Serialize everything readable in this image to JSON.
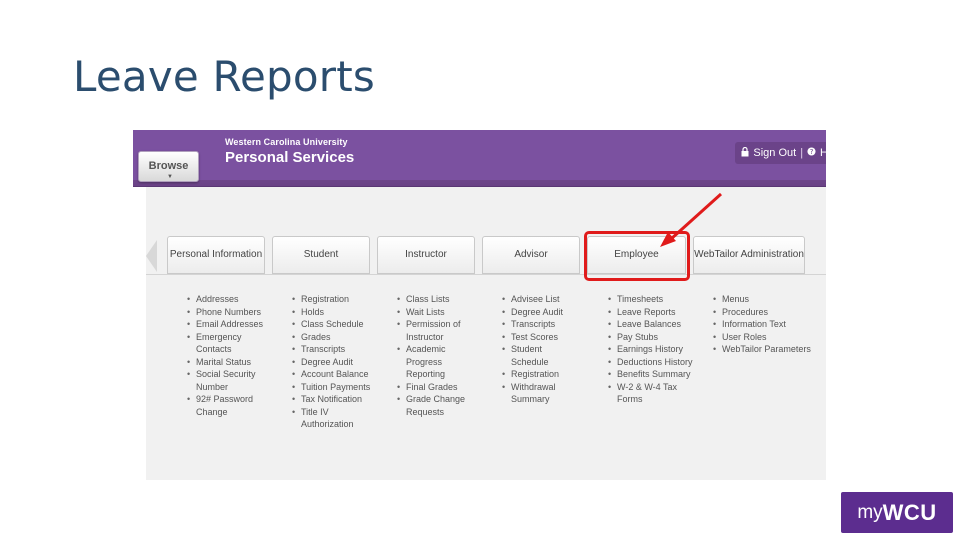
{
  "slide": {
    "title": "Leave Reports"
  },
  "header": {
    "browse_label": "Browse",
    "university": "Western Carolina University",
    "app_name": "Personal Services",
    "sign_out_label": "Sign Out",
    "help_label": "H"
  },
  "tabs": [
    {
      "label": "Personal Information"
    },
    {
      "label": "Student"
    },
    {
      "label": "Instructor"
    },
    {
      "label": "Advisor"
    },
    {
      "label": "Employee"
    },
    {
      "label": "WebTailor Administration"
    }
  ],
  "columns": {
    "personal_information": [
      "Addresses",
      "Phone Numbers",
      "Email Addresses",
      "Emergency Contacts",
      "Marital Status",
      "Social Security Number",
      "92# Password Change"
    ],
    "student": [
      "Registration",
      "Holds",
      "Class Schedule",
      "Grades",
      "Transcripts",
      "Degree Audit",
      "Account Balance",
      "Tuition Payments",
      "Tax Notification",
      "Title IV Authorization"
    ],
    "instructor": [
      "Class Lists",
      "Wait Lists",
      "Permission of Instructor",
      "Academic Progress Reporting",
      "Final Grades",
      "Grade Change Requests"
    ],
    "advisor": [
      "Advisee List",
      "Degree Audit",
      "Transcripts",
      "Test Scores",
      "Student Schedule",
      "Registration",
      "Withdrawal Summary"
    ],
    "employee": [
      "Timesheets",
      "Leave Reports",
      "Leave Balances",
      "Pay Stubs",
      "Earnings History",
      "Deductions History",
      "Benefits Summary",
      "W-2 & W-4 Tax Forms"
    ],
    "webtailor_administration": [
      "Menus",
      "Procedures",
      "Information Text",
      "User Roles",
      "WebTailor Parameters"
    ]
  },
  "logo": {
    "my": "my",
    "wcu": "WCU"
  },
  "colors": {
    "title": "#2b4d6e",
    "header_purple": "#7b51a0",
    "highlight_red": "#e01b1b",
    "logo_purple": "#5c2d8f"
  },
  "icons": {
    "sign_out": "lock-icon",
    "help": "help-icon",
    "annotation": "arrow-icon"
  }
}
